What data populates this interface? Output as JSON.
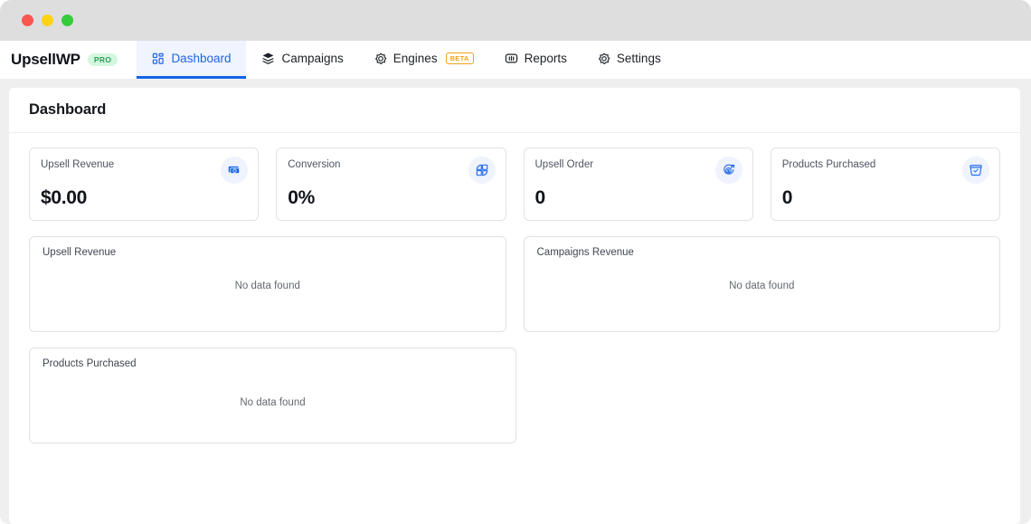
{
  "window": {
    "traffic_lights": [
      "close",
      "minimize",
      "maximize"
    ]
  },
  "topnav": {
    "brand": "UpsellWP",
    "brand_badge": "PRO",
    "items": [
      {
        "label": "Dashboard",
        "icon": "grid-icon",
        "active": true,
        "badge": null
      },
      {
        "label": "Campaigns",
        "icon": "layers-icon",
        "active": false,
        "badge": null
      },
      {
        "label": "Engines",
        "icon": "target-icon",
        "active": false,
        "badge": "BETA"
      },
      {
        "label": "Reports",
        "icon": "report-chart-icon",
        "active": false,
        "badge": null
      },
      {
        "label": "Settings",
        "icon": "gear-icon",
        "active": false,
        "badge": null
      }
    ]
  },
  "page": {
    "title": "Dashboard"
  },
  "stats": [
    {
      "label": "Upsell Revenue",
      "value": "$0.00",
      "icon": "money-icon"
    },
    {
      "label": "Conversion",
      "value": "0%",
      "icon": "conversion-icon"
    },
    {
      "label": "Upsell Order",
      "value": "0",
      "icon": "dollar-target-icon"
    },
    {
      "label": "Products Purchased",
      "value": "0",
      "icon": "basket-check-icon"
    }
  ],
  "panels": [
    {
      "title": "Upsell Revenue",
      "empty_text": "No data found"
    },
    {
      "title": "Campaigns Revenue",
      "empty_text": "No data found"
    },
    {
      "title": "Products Purchased",
      "empty_text": "No data found"
    }
  ],
  "colors": {
    "accent": "#1463e6",
    "accent_soft": "#eff4fe",
    "pro_badge_bg": "#d4f7df",
    "pro_badge_text": "#2f9e5c",
    "beta_badge": "#f2a218",
    "page_bg": "#efeff0",
    "card_border": "#e0e3e8"
  }
}
